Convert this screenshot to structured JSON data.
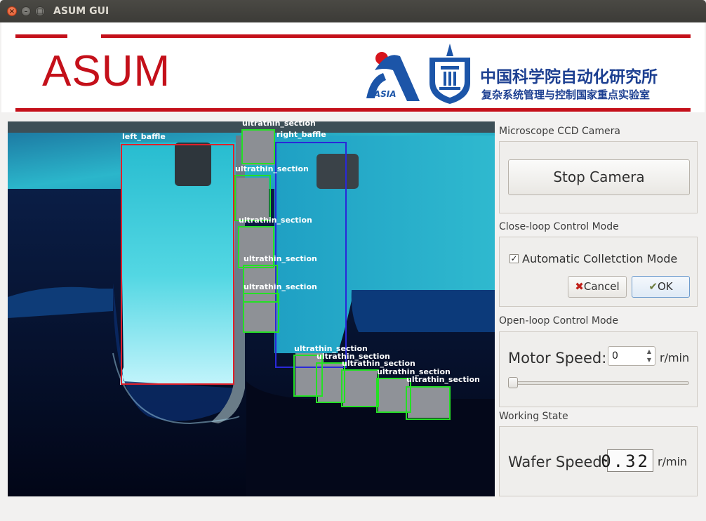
{
  "window": {
    "title": "ASUM GUI"
  },
  "header": {
    "title": "ASUM",
    "logo_text": "CASIA",
    "institution": "中国科学院自动化研究所",
    "lab": "复杂系统管理与控制国家重点实验室"
  },
  "video": {
    "detections": [
      {
        "label": "left_baffle",
        "color": "#e0202a"
      },
      {
        "label": "right_baffle",
        "color": "#2a28d8"
      },
      {
        "label": "ultrathin_section",
        "color": "#25e025"
      }
    ],
    "labels": {
      "left_baffle": "left_baffle",
      "right_baffle": "right_baffle",
      "section": "ultrathin_section"
    }
  },
  "camera": {
    "section_label": "Microscope CCD Camera",
    "stop_label": "Stop Camera"
  },
  "closeloop": {
    "section_label": "Close-loop Control Mode",
    "auto_label": "Automatic Colletction Mode",
    "auto_checked": true,
    "cancel_label": "Cancel",
    "ok_label": "OK"
  },
  "openloop": {
    "section_label": "Open-loop Control Mode",
    "motor_label": "Motor Speed:",
    "motor_value": "0",
    "motor_unit": "r/min",
    "slider_value": 0
  },
  "state": {
    "section_label": "Working State",
    "wafer_label": "Wafer Speed:",
    "wafer_value": "0.32",
    "wafer_unit": "r/min"
  },
  "colors": {
    "accent_red": "#c4101a",
    "institute_blue": "#1c3f91"
  }
}
